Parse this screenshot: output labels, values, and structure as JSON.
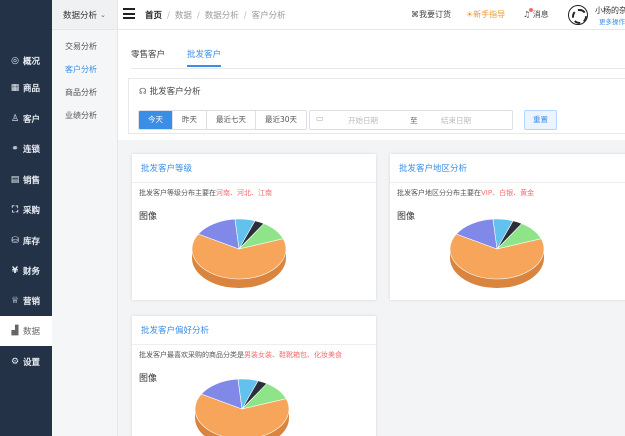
{
  "sidebar": {
    "items": [
      {
        "icon": "compass-icon",
        "glyph": "◎",
        "label": "概况"
      },
      {
        "icon": "grid-icon",
        "glyph": "▦",
        "label": "商品"
      },
      {
        "icon": "user-icon",
        "glyph": "♙",
        "label": "客户"
      },
      {
        "icon": "link-icon",
        "glyph": "⚭",
        "label": "连锁"
      },
      {
        "icon": "sales-icon",
        "glyph": "▤",
        "label": "销售"
      },
      {
        "icon": "purchase-icon",
        "glyph": "⛶",
        "label": "采购"
      },
      {
        "icon": "stock-icon",
        "glyph": "⛁",
        "label": "库存"
      },
      {
        "icon": "finance-icon",
        "glyph": "¥",
        "label": "财务"
      },
      {
        "icon": "marketing-icon",
        "glyph": "♕",
        "label": "营销"
      },
      {
        "icon": "chart-icon",
        "glyph": "▟",
        "label": "数据"
      },
      {
        "icon": "settings-icon",
        "glyph": "⚙",
        "label": "设置"
      }
    ]
  },
  "submenu": {
    "header": "数据分析",
    "items": [
      "交易分析",
      "客户分析",
      "商品分析",
      "业绩分析"
    ]
  },
  "topbar": {
    "breadcrumb": [
      "首页",
      "数据",
      "数据分析",
      "客户分析"
    ],
    "orders": "我要订货",
    "guide": "新手指导",
    "messages": "消息",
    "username": "小杨的杂",
    "more": "更多操作"
  },
  "tabs": [
    "零售客户",
    "批发客户"
  ],
  "filter": {
    "title": "批发客户分析",
    "ranges": [
      "今天",
      "昨天",
      "最近七天",
      "最近30天"
    ],
    "start_placeholder": "开始日期",
    "to": "至",
    "end_placeholder": "结束日期",
    "reset": "重置"
  },
  "cards": [
    {
      "title": "批发客户等级",
      "desc_prefix": "批发客户等级分布主要在",
      "desc_highlight": "河南、河北、江南",
      "desc_suffix": "",
      "img_label": "图像"
    },
    {
      "title": "批发客户地区分析",
      "desc_prefix": "批发客户地区分分布主要在",
      "desc_highlight": "VIP、白银、黄金",
      "desc_suffix": "",
      "img_label": "图像"
    },
    {
      "title": "批发客户偏好分析",
      "desc_prefix": "批发客户最喜欢采购的商品分类是",
      "desc_highlight": "男装女装、鞋靴箱包、化妆美食",
      "desc_suffix": "",
      "img_label": "图像"
    }
  ],
  "pie_colors": [
    "#f6a55a",
    "#8088e8",
    "#63c1ee",
    "#2b2f3a",
    "#8fe48a"
  ]
}
